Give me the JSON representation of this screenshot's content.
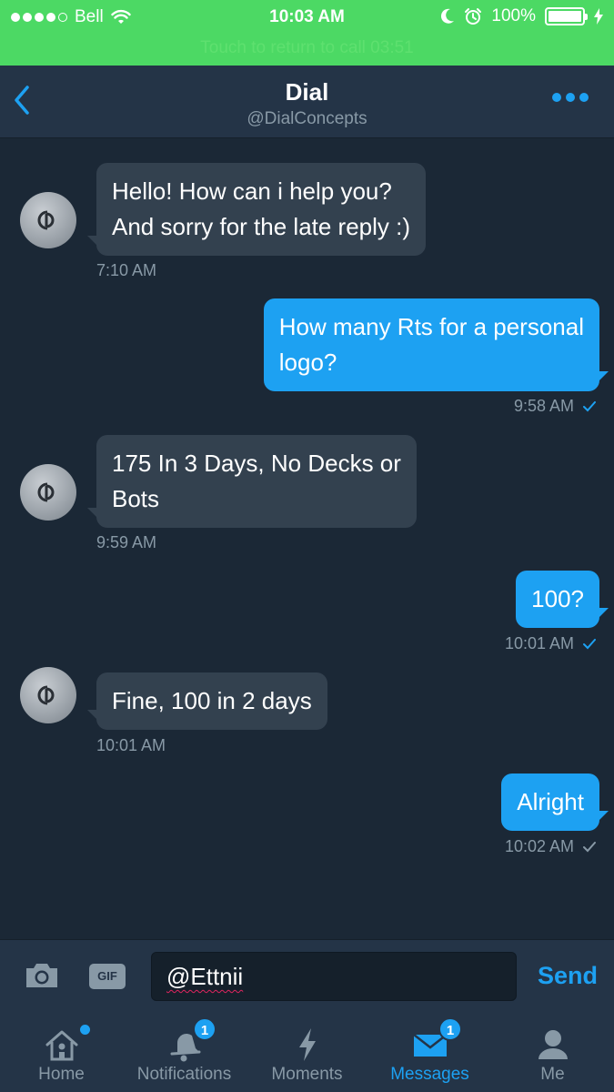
{
  "status_bar": {
    "carrier": "Bell",
    "time": "10:03 AM",
    "battery_percent": "100%",
    "battery_level": 1.0,
    "call_banner": "Touch to return to call 03:51"
  },
  "header": {
    "title": "Dial",
    "handle": "@DialConcepts"
  },
  "messages": [
    {
      "direction": "in",
      "lines": [
        "Hello! How can i help you?",
        "And sorry for the late reply :)"
      ],
      "time": "7:10 AM"
    },
    {
      "direction": "out",
      "lines": [
        "How many Rts for a personal",
        "logo?"
      ],
      "time": "9:58 AM",
      "status": "read"
    },
    {
      "direction": "in",
      "lines": [
        "175 In 3 Days, No Decks or",
        "Bots"
      ],
      "time": "9:59 AM"
    },
    {
      "direction": "out",
      "lines": [
        "100?"
      ],
      "time": "10:01 AM",
      "status": "read"
    },
    {
      "direction": "in",
      "lines": [
        "Fine, 100 in 2 days"
      ],
      "time": "10:01 AM"
    },
    {
      "direction": "out",
      "lines": [
        "Alright"
      ],
      "time": "10:02 AM",
      "status": "sent"
    }
  ],
  "composer": {
    "gif_label": "GIF",
    "input_value": "@Ettnii",
    "send_label": "Send"
  },
  "tabs": [
    {
      "label": "Home",
      "icon": "home-icon",
      "has_dot": true
    },
    {
      "label": "Notifications",
      "icon": "bell-icon",
      "badge": "1"
    },
    {
      "label": "Moments",
      "icon": "lightning-icon"
    },
    {
      "label": "Messages",
      "icon": "envelope-icon",
      "badge": "1",
      "active": true
    },
    {
      "label": "Me",
      "icon": "person-icon"
    }
  ],
  "colors": {
    "accent": "#1da1f2",
    "background": "#1b2836",
    "call_green": "#4cd964"
  }
}
